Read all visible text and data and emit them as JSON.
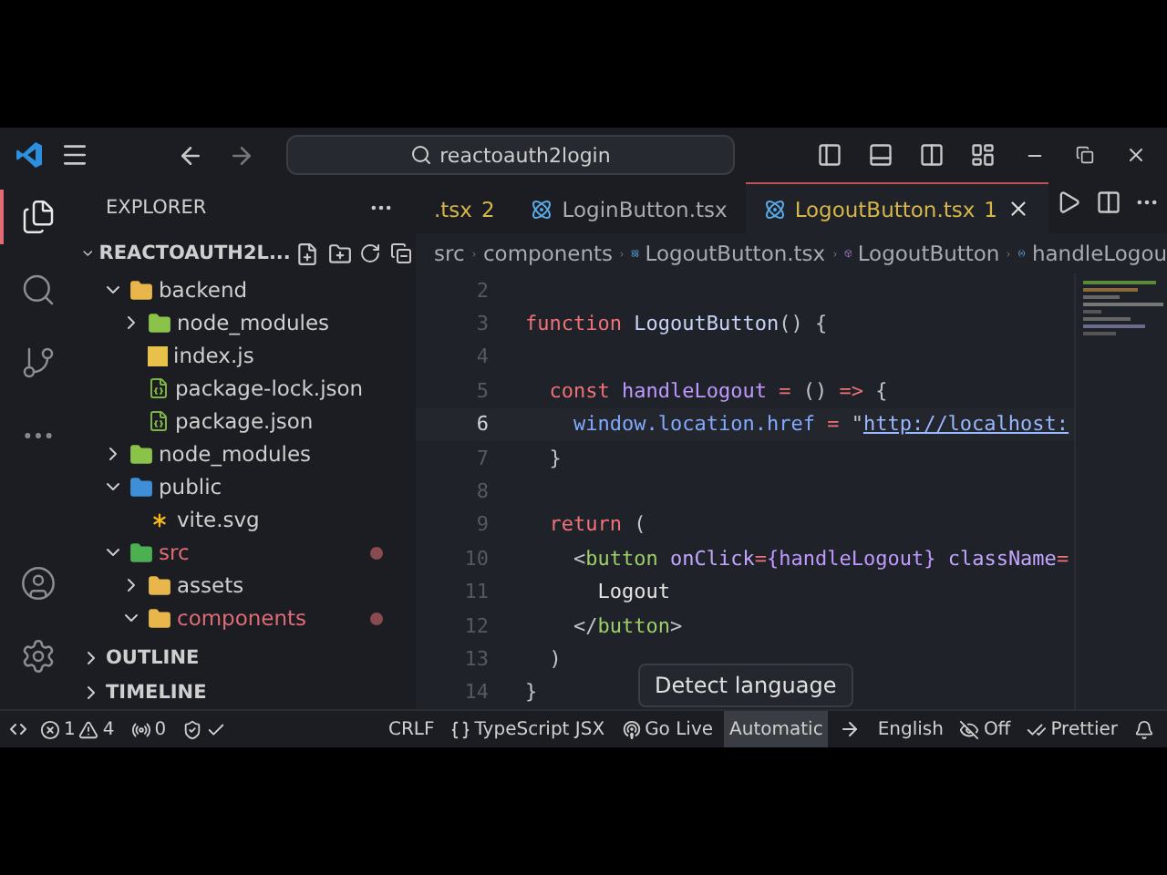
{
  "title_bar": {
    "search": "reactoauth2login"
  },
  "activity_bar": [
    {
      "kind": "explorer",
      "selected": true
    },
    {
      "kind": "search",
      "selected": false
    },
    {
      "kind": "source-control",
      "selected": false
    },
    {
      "kind": "more",
      "selected": false
    },
    {
      "kind": "account",
      "selected": false
    },
    {
      "kind": "settings",
      "selected": false
    }
  ],
  "sidebar": {
    "title": "EXPLORER",
    "root": "REACTOAUTH2L...",
    "tree": [
      {
        "label": "backend",
        "kind": "folder",
        "color": "#e8b64a",
        "expanded": true,
        "modified": false,
        "children": [
          {
            "label": "node_modules",
            "kind": "folder",
            "color": "#8bc34a",
            "expanded": false,
            "modified": false
          },
          {
            "label": "index.js",
            "kind": "js",
            "modified": false
          },
          {
            "label": "package-lock.json",
            "kind": "json",
            "modified": false
          },
          {
            "label": "package.json",
            "kind": "json",
            "modified": false
          }
        ]
      },
      {
        "label": "node_modules",
        "kind": "folder",
        "color": "#8bc34a",
        "expanded": false,
        "modified": false
      },
      {
        "label": "public",
        "kind": "folder",
        "color": "#3f8fd8",
        "expanded": true,
        "modified": false,
        "children": [
          {
            "label": "vite.svg",
            "kind": "svg",
            "modified": false
          }
        ]
      },
      {
        "label": "src",
        "kind": "folder",
        "color": "#4caf50",
        "expanded": true,
        "modified": true,
        "children": [
          {
            "label": "assets",
            "kind": "folder",
            "color": "#e8b64a",
            "expanded": false,
            "modified": false
          },
          {
            "label": "components",
            "kind": "folder",
            "color": "#e8b64a",
            "expanded": true,
            "modified": true
          }
        ]
      }
    ],
    "sections": [
      "OUTLINE",
      "TIMELINE"
    ]
  },
  "tabs": [
    {
      "label": ".tsx",
      "badge": "2",
      "selected": false
    },
    {
      "label": "LoginButton.tsx",
      "selected": false
    },
    {
      "label": "LogoutButton.tsx",
      "badge": "1",
      "selected": true
    }
  ],
  "breadcrumb": [
    {
      "kind": "folder",
      "label": "src"
    },
    {
      "kind": "folder",
      "label": "components"
    },
    {
      "kind": "file",
      "label": "LogoutButton.tsx"
    },
    {
      "kind": "component",
      "label": "LogoutButton"
    },
    {
      "kind": "variable",
      "label": "handleLogou"
    }
  ],
  "code": [
    {
      "number": "2",
      "current": false
    },
    {
      "number": "3",
      "current": false,
      "tokens": [
        {
          "text": "function ",
          "kind": "kw"
        },
        {
          "text": "LogoutButton",
          "kind": "name"
        },
        {
          "text": "() {",
          "kind": "punc"
        }
      ]
    },
    {
      "number": "4",
      "current": false
    },
    {
      "number": "5",
      "current": false,
      "tokens": [
        {
          "text": "  const ",
          "kind": "kw"
        },
        {
          "text": "handleLogout",
          "kind": "var"
        },
        {
          "text": " = ",
          "kind": "op"
        },
        {
          "text": "() ",
          "kind": "punc"
        },
        {
          "text": "=>",
          "kind": "op"
        },
        {
          "text": " {",
          "kind": "punc"
        }
      ]
    },
    {
      "number": "6",
      "current": true,
      "tokens": [
        {
          "text": "    window.location.href",
          "kind": "prop"
        },
        {
          "text": " = ",
          "kind": "op"
        },
        {
          "text": "\"",
          "kind": "punc"
        },
        {
          "text": "http://localhost:",
          "kind": "link"
        }
      ]
    },
    {
      "number": "7",
      "current": false,
      "tokens": [
        {
          "text": "  }",
          "kind": "punc"
        }
      ]
    },
    {
      "number": "8",
      "current": false
    },
    {
      "number": "9",
      "current": false,
      "tokens": [
        {
          "text": "  return ",
          "kind": "kw"
        },
        {
          "text": "(",
          "kind": "punc"
        }
      ]
    },
    {
      "number": "10",
      "current": false,
      "tokens": [
        {
          "text": "    <",
          "kind": "punc"
        },
        {
          "text": "button",
          "kind": "tag"
        },
        {
          "text": " onClick",
          "kind": "attr"
        },
        {
          "text": "=",
          "kind": "op"
        },
        {
          "text": "{handleLogout}",
          "kind": "var"
        },
        {
          "text": " className",
          "kind": "attr"
        },
        {
          "text": "=",
          "kind": "op"
        }
      ]
    },
    {
      "number": "11",
      "current": false,
      "tokens": [
        {
          "text": "      Logout",
          "kind": "text"
        }
      ]
    },
    {
      "number": "12",
      "current": false,
      "tokens": [
        {
          "text": "    </",
          "kind": "punc"
        },
        {
          "text": "button",
          "kind": "tag"
        },
        {
          "text": ">",
          "kind": "punc"
        }
      ]
    },
    {
      "number": "13",
      "current": false,
      "tokens": [
        {
          "text": "  )",
          "kind": "punc"
        }
      ]
    },
    {
      "number": "14",
      "current": false,
      "tokens": [
        {
          "text": "}",
          "kind": "punc"
        }
      ]
    }
  ],
  "tooltip": "Detect language",
  "status_bar": {
    "errors": "1",
    "warnings": "4",
    "ports": "0",
    "items": [
      {
        "kind": "text",
        "label": "CRLF",
        "hovered": false
      },
      {
        "kind": "braces",
        "label": "TypeScript JSX",
        "hovered": false
      },
      {
        "kind": "broadcast",
        "label": "Go Live",
        "hovered": false
      },
      {
        "kind": "text",
        "label": "Automatic",
        "hovered": true
      },
      {
        "kind": "arrow",
        "hovered": false
      },
      {
        "kind": "text",
        "label": "English",
        "hovered": false
      },
      {
        "kind": "eye-off",
        "label": "Off",
        "hovered": false
      },
      {
        "kind": "double-check",
        "label": "Prettier",
        "hovered": false
      },
      {
        "kind": "bell",
        "hovered": false
      }
    ]
  }
}
